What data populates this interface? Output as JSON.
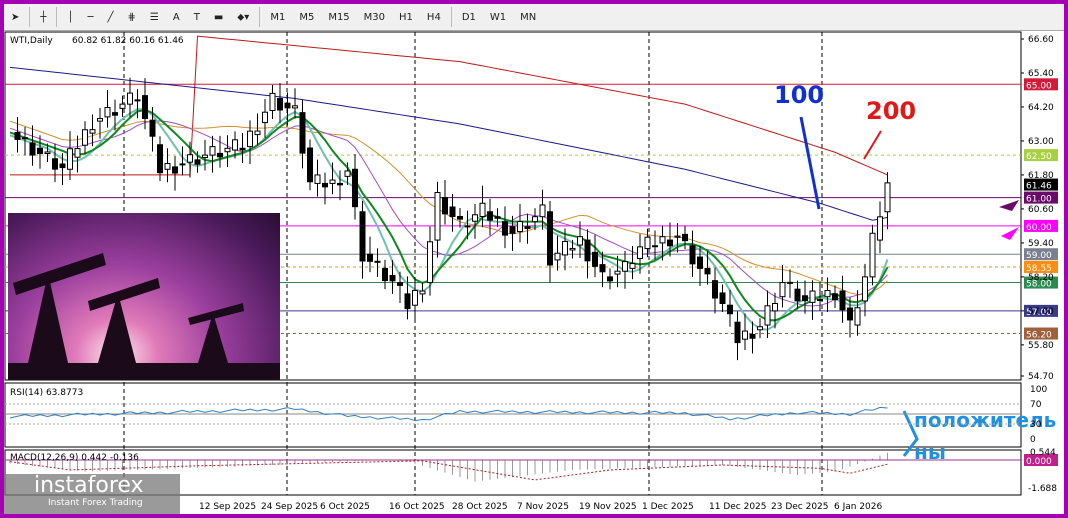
{
  "toolbar": {
    "tools": [
      "cursor-icon",
      "crosshair-icon",
      "vertical-line-icon",
      "horizontal-line-icon",
      "trendline-icon",
      "fibo-icon",
      "fibo-levels-icon",
      "text-icon",
      "text-label-icon",
      "rectangle-icon",
      "arrows-icon"
    ],
    "labels": {
      "text": "A",
      "timeframes": [
        "M1",
        "M5",
        "M15",
        "M30",
        "H1",
        "H4",
        "D1",
        "W1",
        "MN"
      ]
    }
  },
  "chart": {
    "symbol_label": "WTI,Daily",
    "ohlc": "60.82 61.82 60.16 61.46",
    "price_ticks": [
      "66.60",
      "65.40",
      "64.20",
      "63.00",
      "61.80",
      "60.60",
      "59.40",
      "58.20",
      "57.00",
      "55.80",
      "54.70"
    ],
    "price_ticks_values": [
      66.6,
      65.4,
      64.2,
      63.0,
      61.8,
      60.6,
      59.4,
      58.2,
      57.0,
      55.8,
      54.7
    ],
    "levels": [
      {
        "label": "65.00",
        "value": 65.0,
        "color": "#d41a3a",
        "dash": false
      },
      {
        "label": "62.50",
        "value": 62.5,
        "color": "#a8d040",
        "dash": true
      },
      {
        "label": "61.46",
        "value": 61.46,
        "color": "#000000",
        "dash": false
      },
      {
        "label": "61.00",
        "value": 61.0,
        "color": "#6a0a6a",
        "dash": false
      },
      {
        "label": "60.00",
        "value": 60.0,
        "color": "#ff00ff",
        "dash": false
      },
      {
        "label": "59.00",
        "value": 59.0,
        "color": "#7a8090",
        "dash": false
      },
      {
        "label": "58.55",
        "value": 58.55,
        "color": "#ff8c10",
        "dash": true
      },
      {
        "label": "58.00",
        "value": 58.0,
        "color": "#2a8a50",
        "dash": false
      },
      {
        "label": "57.00",
        "value": 57.0,
        "color": "#3a3a8a",
        "dash": false
      },
      {
        "label": "56.20",
        "value": 56.2,
        "color": "#a0603a",
        "dash": true
      }
    ],
    "annotation_100": "100",
    "annotation_200": "200",
    "annotation_positive_1": "положитель",
    "annotation_positive_2": "ны"
  },
  "rsi": {
    "label": "RSI(14) 63.8773",
    "ticks": [
      "100",
      "70",
      "30",
      "0"
    ]
  },
  "macd": {
    "label": "MACD(12,26,9) 0.442 -0.136",
    "ticks": [
      "0.544",
      "0.000",
      "-1.688"
    ]
  },
  "dates": [
    "12 Sep 2025",
    "24 Sep 2025",
    "6 Oct 2025",
    "16 Oct 2025",
    "28 Oct 2025",
    "7 Nov 2025",
    "19 Nov 2025",
    "1 Dec 2025",
    "11 Dec 2025",
    "23 Dec 2025",
    "6 Jan 2026"
  ],
  "logo": {
    "name": "instaforex",
    "tagline": "Instant Forex Trading"
  },
  "chart_data": {
    "type": "candlestick",
    "title": "WTI,Daily",
    "ylim": [
      54.7,
      66.6
    ],
    "close_keypoints": [
      [
        0,
        63.3
      ],
      [
        7,
        62.0
      ],
      [
        11,
        63.7
      ],
      [
        17,
        64.6
      ],
      [
        20,
        62.0
      ],
      [
        26,
        62.5
      ],
      [
        31,
        62.8
      ],
      [
        35,
        64.5
      ],
      [
        38,
        64.0
      ],
      [
        40,
        61.5
      ],
      [
        43,
        61.5
      ],
      [
        45,
        62.0
      ],
      [
        47,
        59.0
      ],
      [
        51,
        58.0
      ],
      [
        53,
        57.2
      ],
      [
        55,
        58.0
      ],
      [
        57,
        61.0
      ],
      [
        60,
        60.0
      ],
      [
        63,
        60.5
      ],
      [
        67,
        59.8
      ],
      [
        71,
        60.5
      ],
      [
        72,
        58.8
      ],
      [
        76,
        59.5
      ],
      [
        79,
        58.2
      ],
      [
        82,
        58.5
      ],
      [
        84,
        59.2
      ],
      [
        89,
        59.7
      ],
      [
        92,
        58.5
      ],
      [
        95,
        57.2
      ],
      [
        97,
        56.0
      ],
      [
        100,
        56.5
      ],
      [
        103,
        58.0
      ],
      [
        106,
        57.3
      ],
      [
        110,
        57.7
      ],
      [
        112,
        56.5
      ],
      [
        114,
        58.2
      ],
      [
        115,
        59.5
      ],
      [
        116,
        60.5
      ],
      [
        117,
        61.46
      ]
    ],
    "ma200_keypoints": [
      [
        25,
        66.7
      ],
      [
        60,
        65.8
      ],
      [
        90,
        64.3
      ],
      [
        110,
        62.6
      ],
      [
        117,
        61.8
      ]
    ],
    "ma100_keypoints": [
      [
        0,
        65.6
      ],
      [
        38,
        64.5
      ],
      [
        60,
        63.6
      ],
      [
        90,
        62.0
      ],
      [
        108,
        60.8
      ],
      [
        115,
        60.2
      ],
      [
        117,
        60.3
      ]
    ],
    "rsi_keypoints": [
      [
        0,
        45
      ],
      [
        20,
        53
      ],
      [
        38,
        60
      ],
      [
        45,
        46
      ],
      [
        55,
        38
      ],
      [
        60,
        55
      ],
      [
        90,
        52
      ],
      [
        96,
        40
      ],
      [
        105,
        53
      ],
      [
        112,
        50
      ],
      [
        117,
        64
      ]
    ],
    "macd_signal_keypoints": [
      [
        0,
        -0.1
      ],
      [
        8,
        -0.6
      ],
      [
        25,
        -0.35
      ],
      [
        40,
        -0.2
      ],
      [
        55,
        -0.05
      ],
      [
        70,
        -1.2
      ],
      [
        80,
        -0.6
      ],
      [
        95,
        -0.3
      ],
      [
        108,
        -0.5
      ],
      [
        112,
        -0.8
      ],
      [
        117,
        -0.25
      ]
    ],
    "macd_hist_keypoints": [
      [
        0,
        -0.2
      ],
      [
        10,
        -0.7
      ],
      [
        30,
        -0.4
      ],
      [
        52,
        0.05
      ],
      [
        62,
        -1.3
      ],
      [
        75,
        -0.6
      ],
      [
        95,
        -0.3
      ],
      [
        105,
        -0.9
      ],
      [
        110,
        -0.7
      ],
      [
        114,
        -0.1
      ],
      [
        117,
        0.44
      ]
    ]
  }
}
